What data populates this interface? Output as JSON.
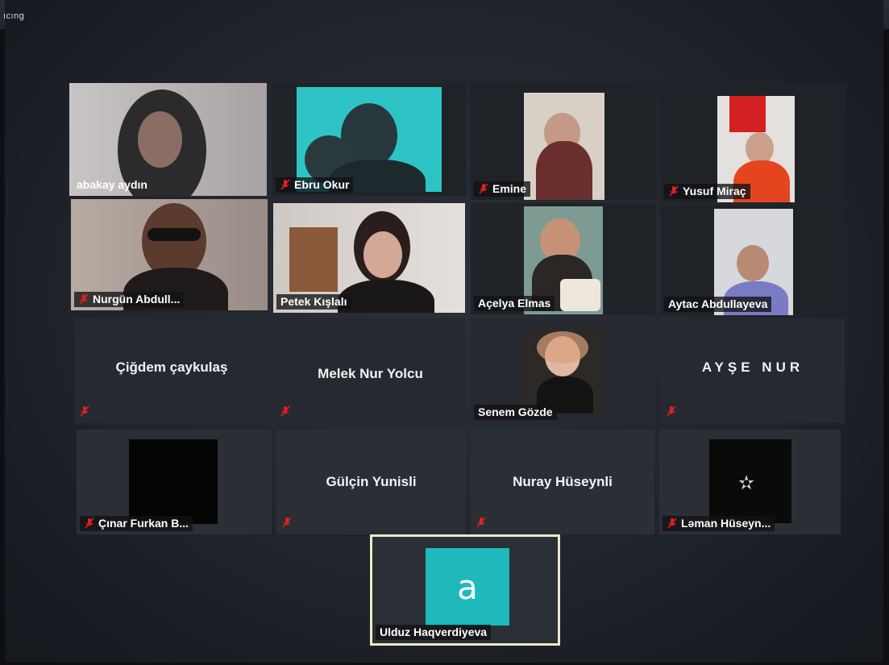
{
  "corner_label": "ıcıng",
  "participants": [
    {
      "name": "abakay aydın"
    },
    {
      "name": "Ebru Okur"
    },
    {
      "name": "Emine"
    },
    {
      "name": "Yusuf Miraç"
    },
    {
      "name": "Nurgün Abdull..."
    },
    {
      "name": "Petek Kışlalı"
    },
    {
      "name": "Açelya Elmas"
    },
    {
      "name": "Aytac Abdullayeva"
    },
    {
      "name": "Çiğdem çaykulaş"
    },
    {
      "name": "Melek Nur Yolcu"
    },
    {
      "name": "Senem Gözde"
    },
    {
      "name": "AYŞE NUR"
    },
    {
      "name": "Çınar Furkan B..."
    },
    {
      "name": "Gülçin Yunisli"
    },
    {
      "name": "Nuray Hüseynli"
    },
    {
      "name": "Ləman Hüseyn..."
    }
  ],
  "self_view": {
    "name": "Ulduz Haqverdiyeva",
    "initial": "a"
  },
  "colors": {
    "mute_red": "#e02020",
    "self_highlight": "#ece9c6",
    "avatar_teal": "#1fb9bd"
  }
}
